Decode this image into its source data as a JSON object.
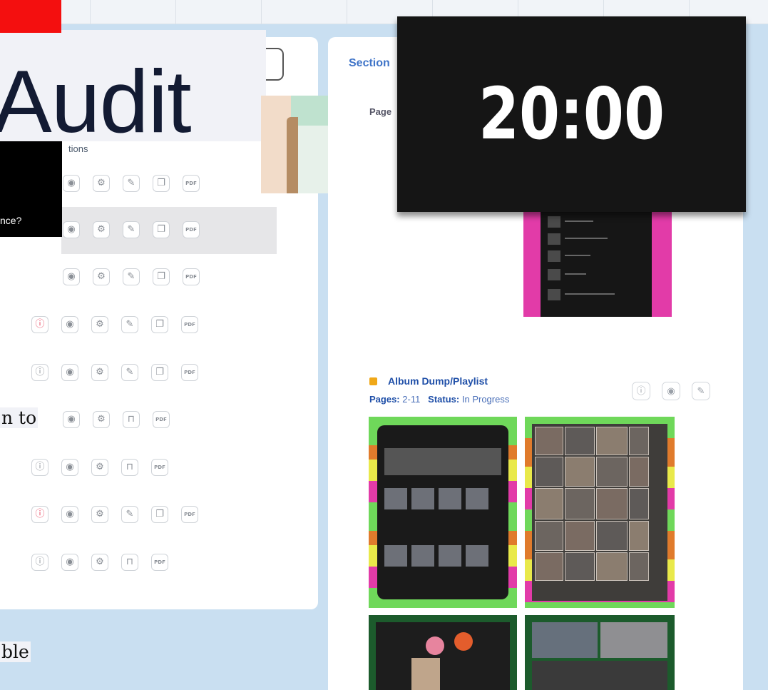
{
  "title_overlay": {
    "text": "Audit"
  },
  "timer": {
    "display": "20:00"
  },
  "left_panel": {
    "operations_label": "tions",
    "tooltip_text": "nce?",
    "fragment_text_1": "n to",
    "fragment_text_2": "ble"
  },
  "right_panel": {
    "section_tab": "Section",
    "page_fragment": "Page",
    "album": {
      "title": "Album Dump/Playlist",
      "pages_label": "Pages:",
      "pages_value": "2-11",
      "status_label": "Status:",
      "status_value": "In Progress"
    }
  },
  "icons": {
    "rows": [
      [
        "eye-icon",
        "gear-icon",
        "pencil-icon",
        "copy-icon",
        "pdf-icon"
      ],
      [
        "eye-icon",
        "gear-icon",
        "pencil-icon",
        "copy-icon",
        "pdf-icon"
      ],
      [
        "eye-icon",
        "gear-icon",
        "pencil-icon",
        "copy-icon",
        "pdf-icon"
      ],
      [
        "info-icon",
        "eye-icon",
        "gear-icon",
        "pencil-icon",
        "copy-icon",
        "pdf-icon"
      ],
      [
        "info-icon",
        "eye-icon",
        "gear-icon",
        "pencil-icon",
        "copy-icon",
        "pdf-icon"
      ],
      [
        "eye-icon",
        "gear-icon",
        "lock-icon",
        "pdf-icon"
      ],
      [
        "info-icon",
        "eye-icon",
        "gear-icon",
        "lock-icon",
        "pdf-icon"
      ],
      [
        "info-icon",
        "eye-icon",
        "gear-icon",
        "pencil-icon",
        "copy-icon",
        "pdf-icon"
      ],
      [
        "info-icon",
        "eye-icon",
        "gear-icon",
        "lock-icon",
        "pdf-icon"
      ]
    ],
    "pdf_glyph": "PDF"
  },
  "colors": {
    "background": "#c9dff1",
    "accent_blue": "#1f4fa8",
    "status_dot": "#f0a818",
    "timer_bg": "#151515",
    "title_bar_red": "#f40f0f"
  }
}
